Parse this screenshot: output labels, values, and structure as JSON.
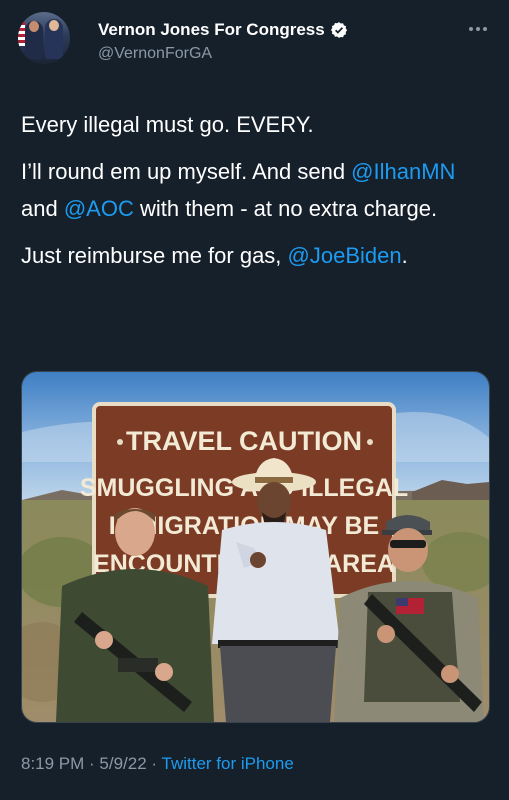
{
  "author": {
    "display_name": "Vernon Jones For Congress",
    "handle": "@VernonForGA",
    "verified_icon": "verified-badge-icon",
    "more_icon": "more-options-icon"
  },
  "tweet": {
    "line1": "Every illegal must go. EVERY.",
    "p2_a": "I’ll round em up myself. And send ",
    "mention_ilhan": "@IlhanMN",
    "p2_b": " and ",
    "mention_aoc": "@AOC",
    "p2_c": " with them - at no extra charge.",
    "p3_a": "Just reimburse me for gas, ",
    "mention_biden": "@JoeBiden",
    "p3_b": "."
  },
  "media": {
    "sign_line1": "TRAVEL CAUTION",
    "sign_line2": "SMUGGLING AND ILLEGAL",
    "sign_line3": "IMMIGRATION MAY BE",
    "sign_line4": "ENCOUNTERED IN AREA"
  },
  "meta": {
    "time": "8:19 PM",
    "sep1": " · ",
    "date": "5/9/22",
    "sep2": " · ",
    "source": "Twitter for iPhone"
  },
  "colors": {
    "background": "#15202b",
    "link": "#1d9bf0",
    "secondary_text": "#8b98a5",
    "sign_brown": "#7b3b25"
  }
}
